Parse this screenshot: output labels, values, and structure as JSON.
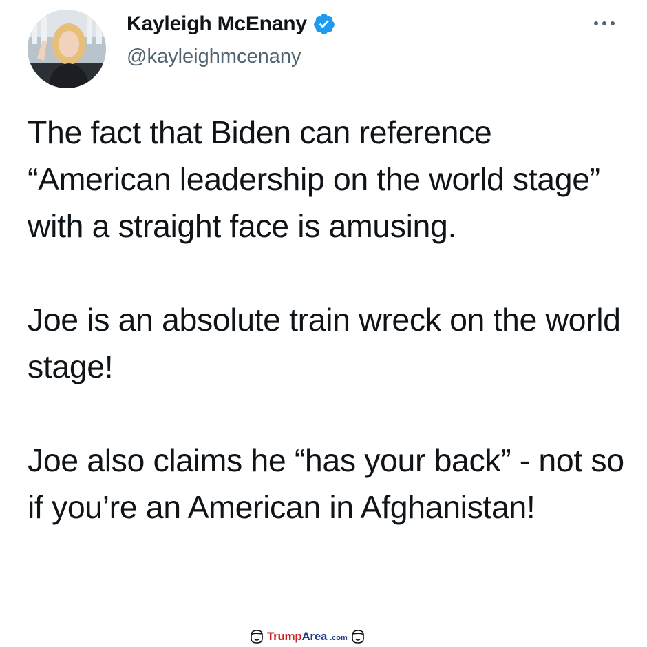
{
  "tweet": {
    "author": {
      "display_name": "Kayleigh McEnany",
      "handle": "@kayleighmcenany",
      "verified": true,
      "avatar_icon": "profile-photo"
    },
    "more_icon": "ellipsis-icon",
    "paragraphs": [
      "The fact that Biden can reference “American leadership on the world stage” with a straight face is amusing.",
      "Joe is an absolute train wreck on the world stage!",
      "Joe also claims he “has your back” - not so if you’re an American in Afghanistan!"
    ]
  },
  "watermark": {
    "brand_part1": "Trump",
    "brand_part2": "Area",
    "domain": ".com"
  },
  "colors": {
    "text": "#0f1419",
    "secondary_text": "#536471",
    "verified_blue": "#1d9bf0",
    "watermark_red": "#c8242b",
    "watermark_blue": "#1f3c88"
  }
}
